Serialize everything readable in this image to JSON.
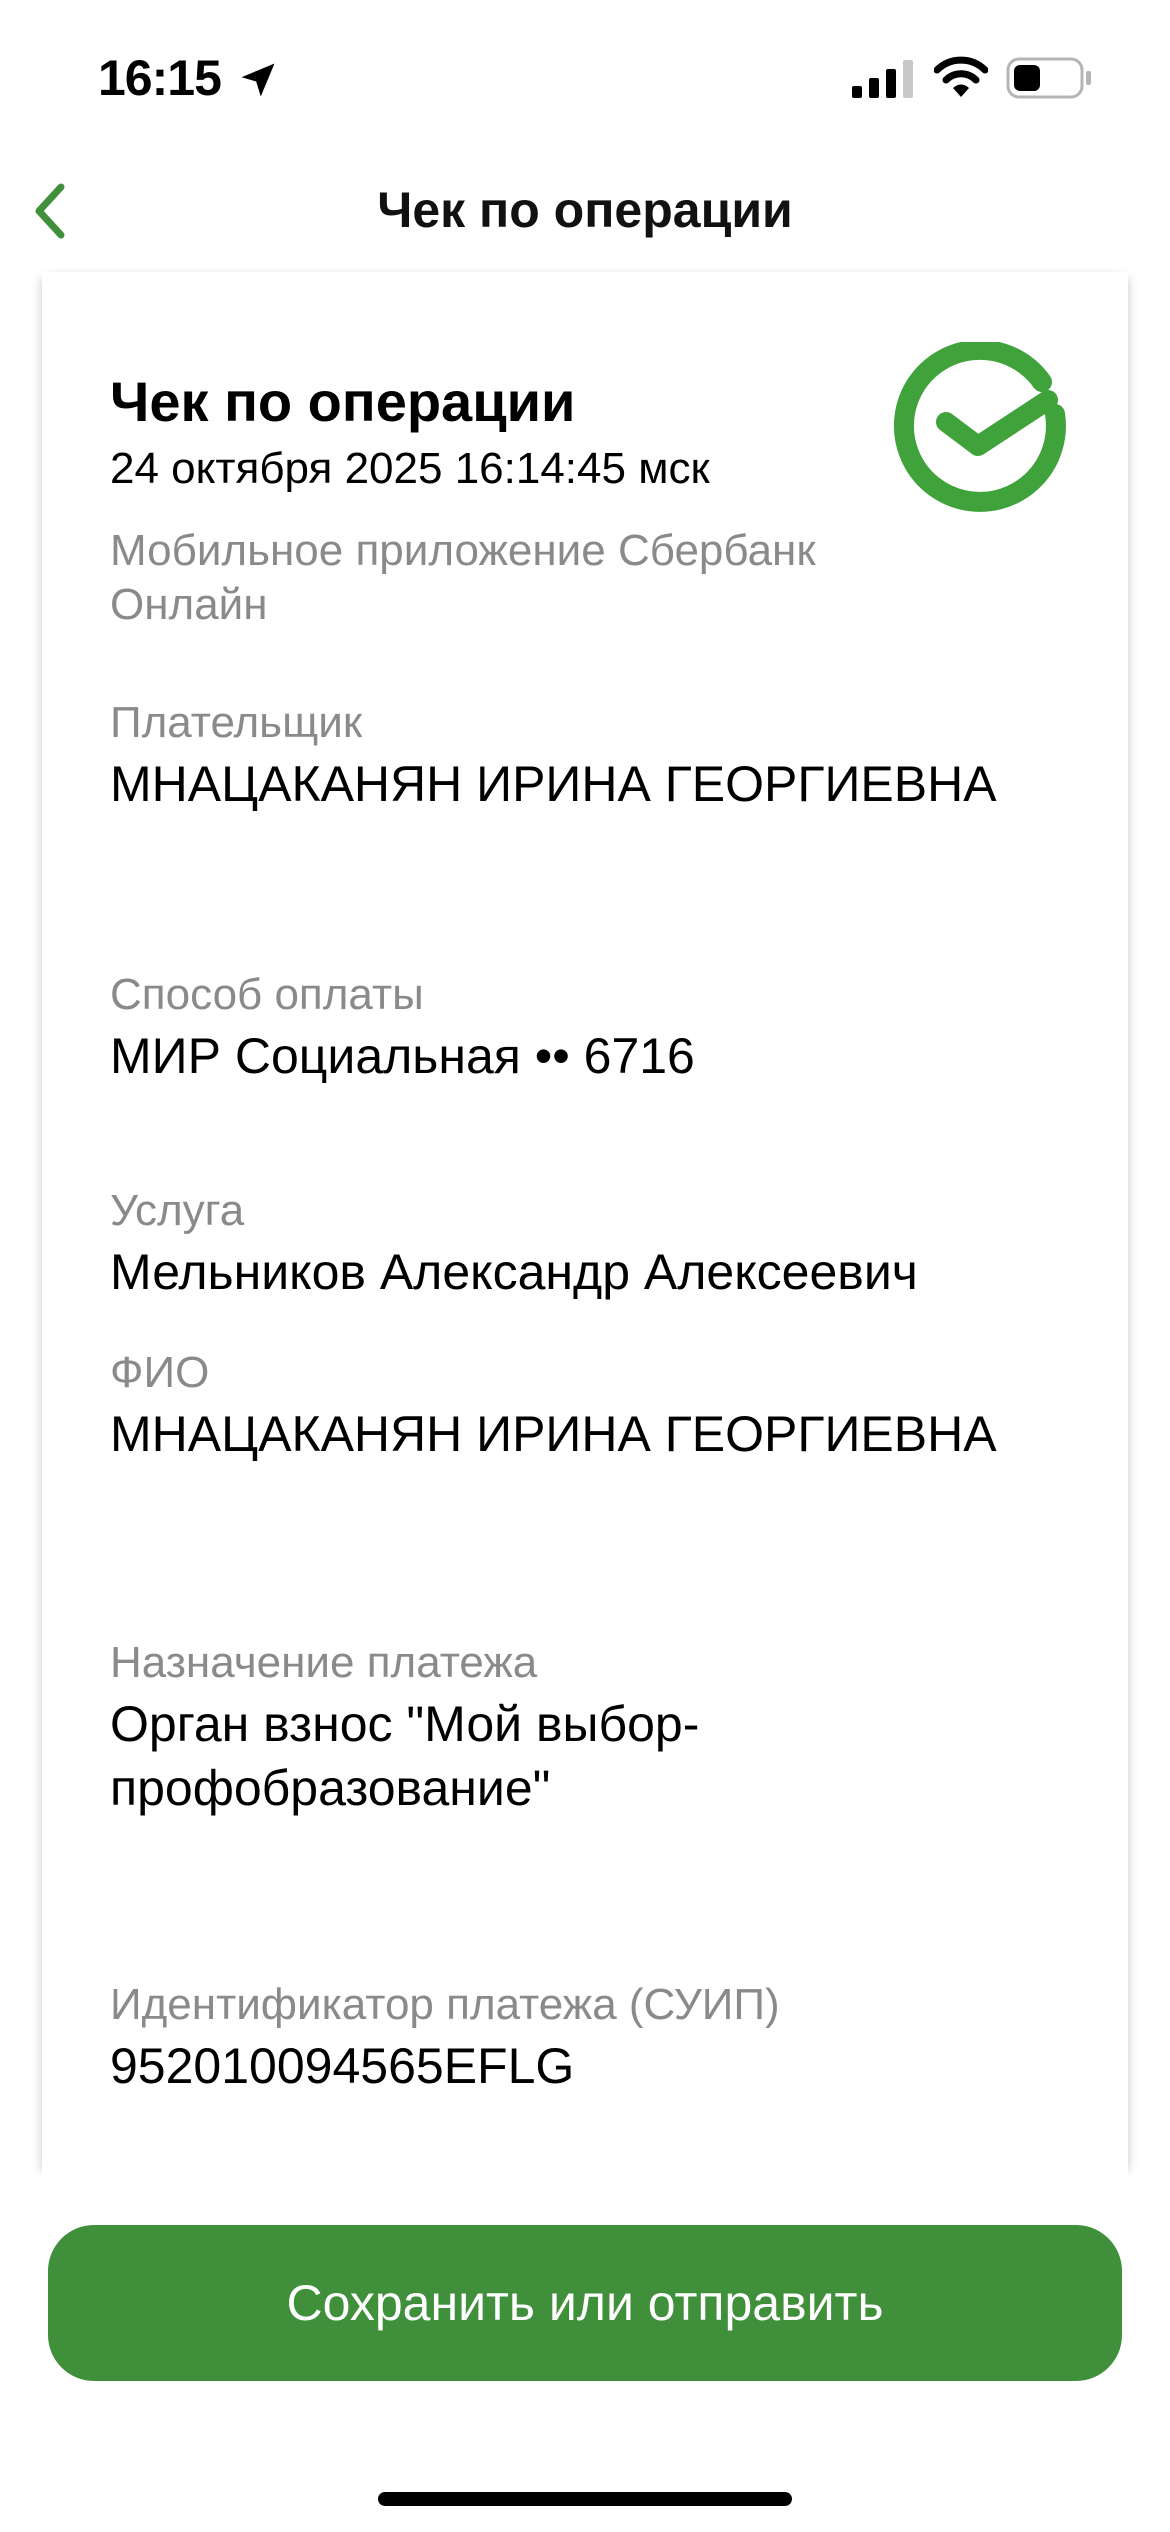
{
  "status_bar": {
    "time": "16:15"
  },
  "nav": {
    "title": "Чек по операции",
    "back_icon": "chevron-left-icon"
  },
  "receipt": {
    "title": "Чек по операции",
    "datetime": "24 октября 2025 16:14:45 мск",
    "source": "Мобильное приложение Сбербанк Онлайн",
    "fields": [
      {
        "label": "Плательщик",
        "value": "МНАЦАКАНЯН ИРИНА ГЕОРГИЕВНА"
      },
      {
        "label": "Способ оплаты",
        "value": "МИР Социальная •• 6716"
      },
      {
        "label": "Услуга",
        "value": "Мельников Александр Алексеевич"
      },
      {
        "label": "ФИО",
        "value": "МНАЦАКАНЯН ИРИНА ГЕОРГИЕВНА"
      },
      {
        "label": "Назначение платежа",
        "value": "Орган взнос \"Мой выбор-профобразование\""
      },
      {
        "label": "Идентификатор платежа (СУИП)",
        "value": "952010094565EFLG"
      }
    ]
  },
  "actions": {
    "save_or_send": "Сохранить или отправить"
  },
  "colors": {
    "brand_green": "#3f8f3b",
    "check_green": "#3fa23a",
    "label_gray": "#8a8a8a"
  }
}
